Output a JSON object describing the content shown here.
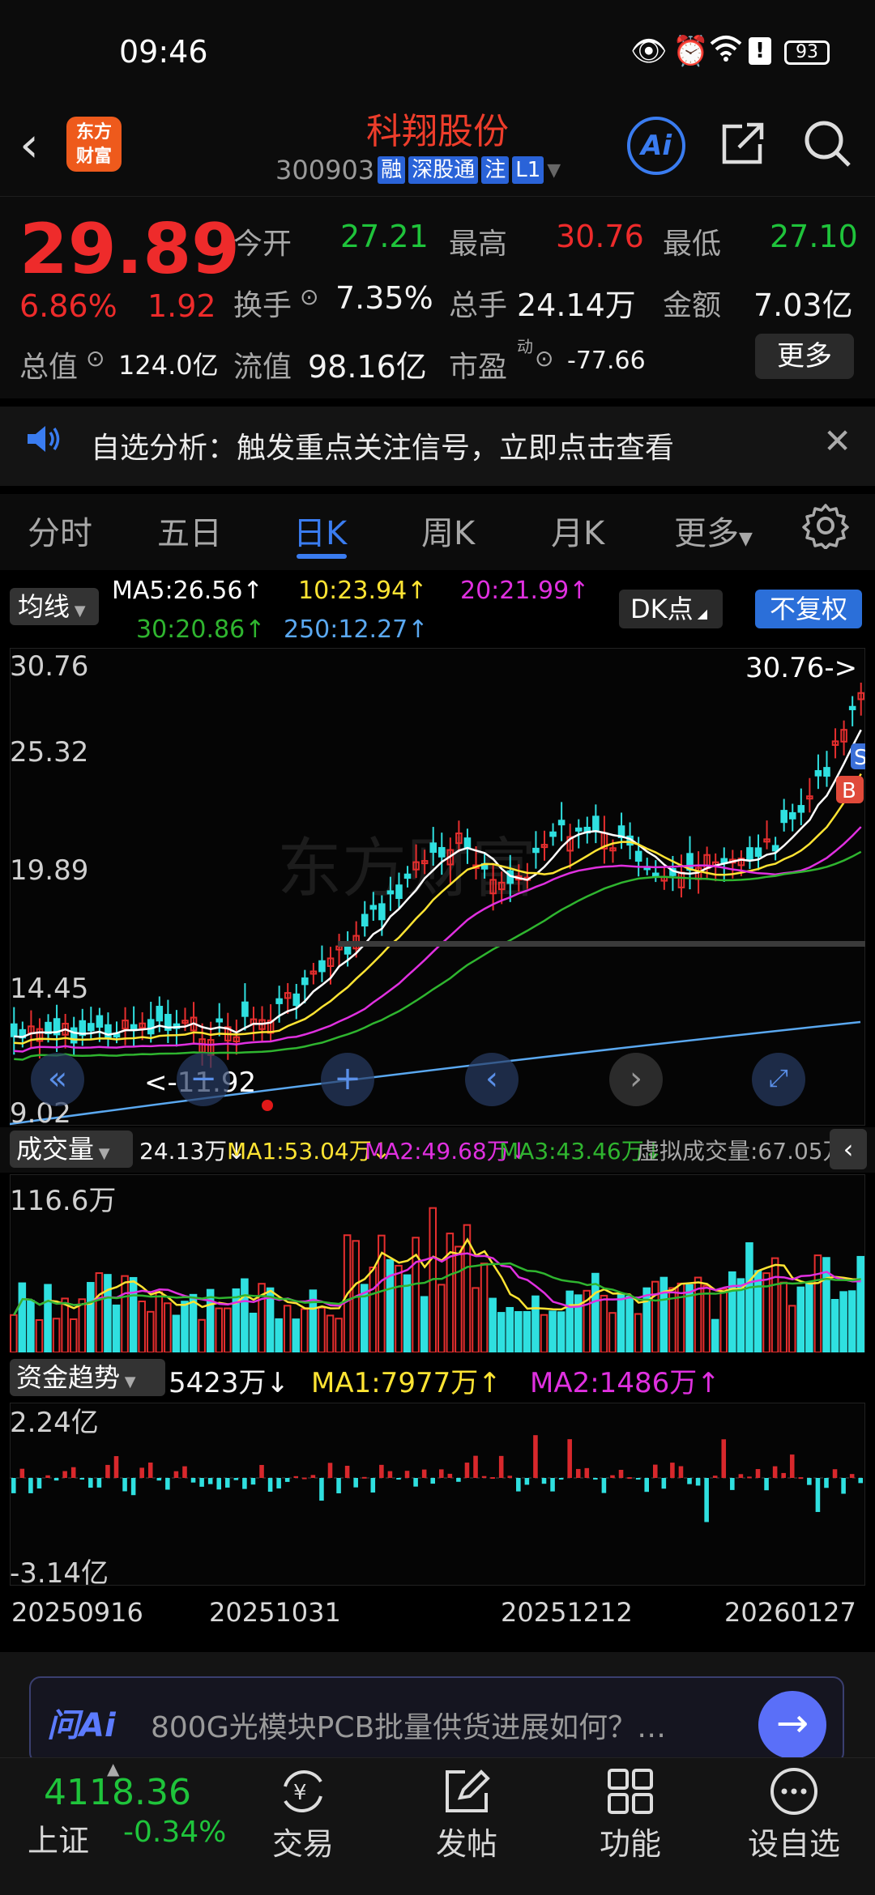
{
  "status": {
    "time": "09:46",
    "battery": "93"
  },
  "header": {
    "stock_name": "科翔股份",
    "code": "300903",
    "tags": [
      "融",
      "深股通",
      "注",
      "L1"
    ],
    "ai_label": "Ai"
  },
  "quote": {
    "price": "29.89",
    "change_pct": "6.86%",
    "change": "1.92",
    "open_label": "今开",
    "open": "27.21",
    "high_label": "最高",
    "high": "30.76",
    "low_label": "最低",
    "low": "27.10",
    "turnover_label": "换手",
    "turnover": "7.35%",
    "volume_label": "总手",
    "volume": "24.14万",
    "amount_label": "金额",
    "amount": "7.03亿",
    "total_value_label": "总值",
    "total_value": "124.0亿",
    "float_value_label": "流值",
    "float_value": "98.16亿",
    "pe_label": "市盈",
    "pe_sup": "动",
    "pe": "-77.66",
    "more_label": "更多"
  },
  "notice": {
    "text": "自选分析：触发重点关注信号，立即点击查看"
  },
  "tabs": [
    "分时",
    "五日",
    "日K",
    "周K",
    "月K",
    "更多"
  ],
  "ma": {
    "button": "均线",
    "ma5": "MA5:26.56↑",
    "ma10": "10:23.94↑",
    "ma20": "20:21.99↑",
    "ma30": "30:20.86↑",
    "ma250": "250:12.27↑",
    "dk_label": "DK点",
    "fq_label": "不复权",
    "colors": {
      "ma5": "#ffffff",
      "ma10": "#ffe433",
      "ma20": "#e030e0",
      "ma30": "#2fb52f",
      "ma250": "#5aa8f0"
    }
  },
  "kline": {
    "y_labels": [
      "30.76",
      "25.32",
      "19.89",
      "14.45",
      "9.02"
    ],
    "max_marker": "30.76->",
    "min_marker": "<-11.92",
    "signals": [
      "S",
      "B"
    ],
    "watermark": "东方财富"
  },
  "volume": {
    "button": "成交量",
    "current": "24.13万↓",
    "ma1": "MA1:53.04万↓",
    "ma2": "MA2:49.68万↓",
    "ma3": "MA3:43.46万↓",
    "virtual": "虚拟成交量:67.05万",
    "y_max": "116.6万"
  },
  "fund": {
    "button": "资金趋势",
    "current": "5423万↓",
    "ma1": "MA1:7977万↑",
    "ma2": "MA2:1486万↑",
    "y_max": "2.24亿",
    "y_min": "-3.14亿"
  },
  "dates": [
    "20250916",
    "20251031",
    "20251212",
    "20260127"
  ],
  "ask": {
    "logo": "问Ai",
    "text": "800G光模块PCB批量供货进展如何？…"
  },
  "bottom": {
    "index_value": "4118.36",
    "index_name": "上证",
    "index_change": "-0.34%",
    "nav": [
      "交易",
      "发帖",
      "功能",
      "设自选"
    ]
  }
}
